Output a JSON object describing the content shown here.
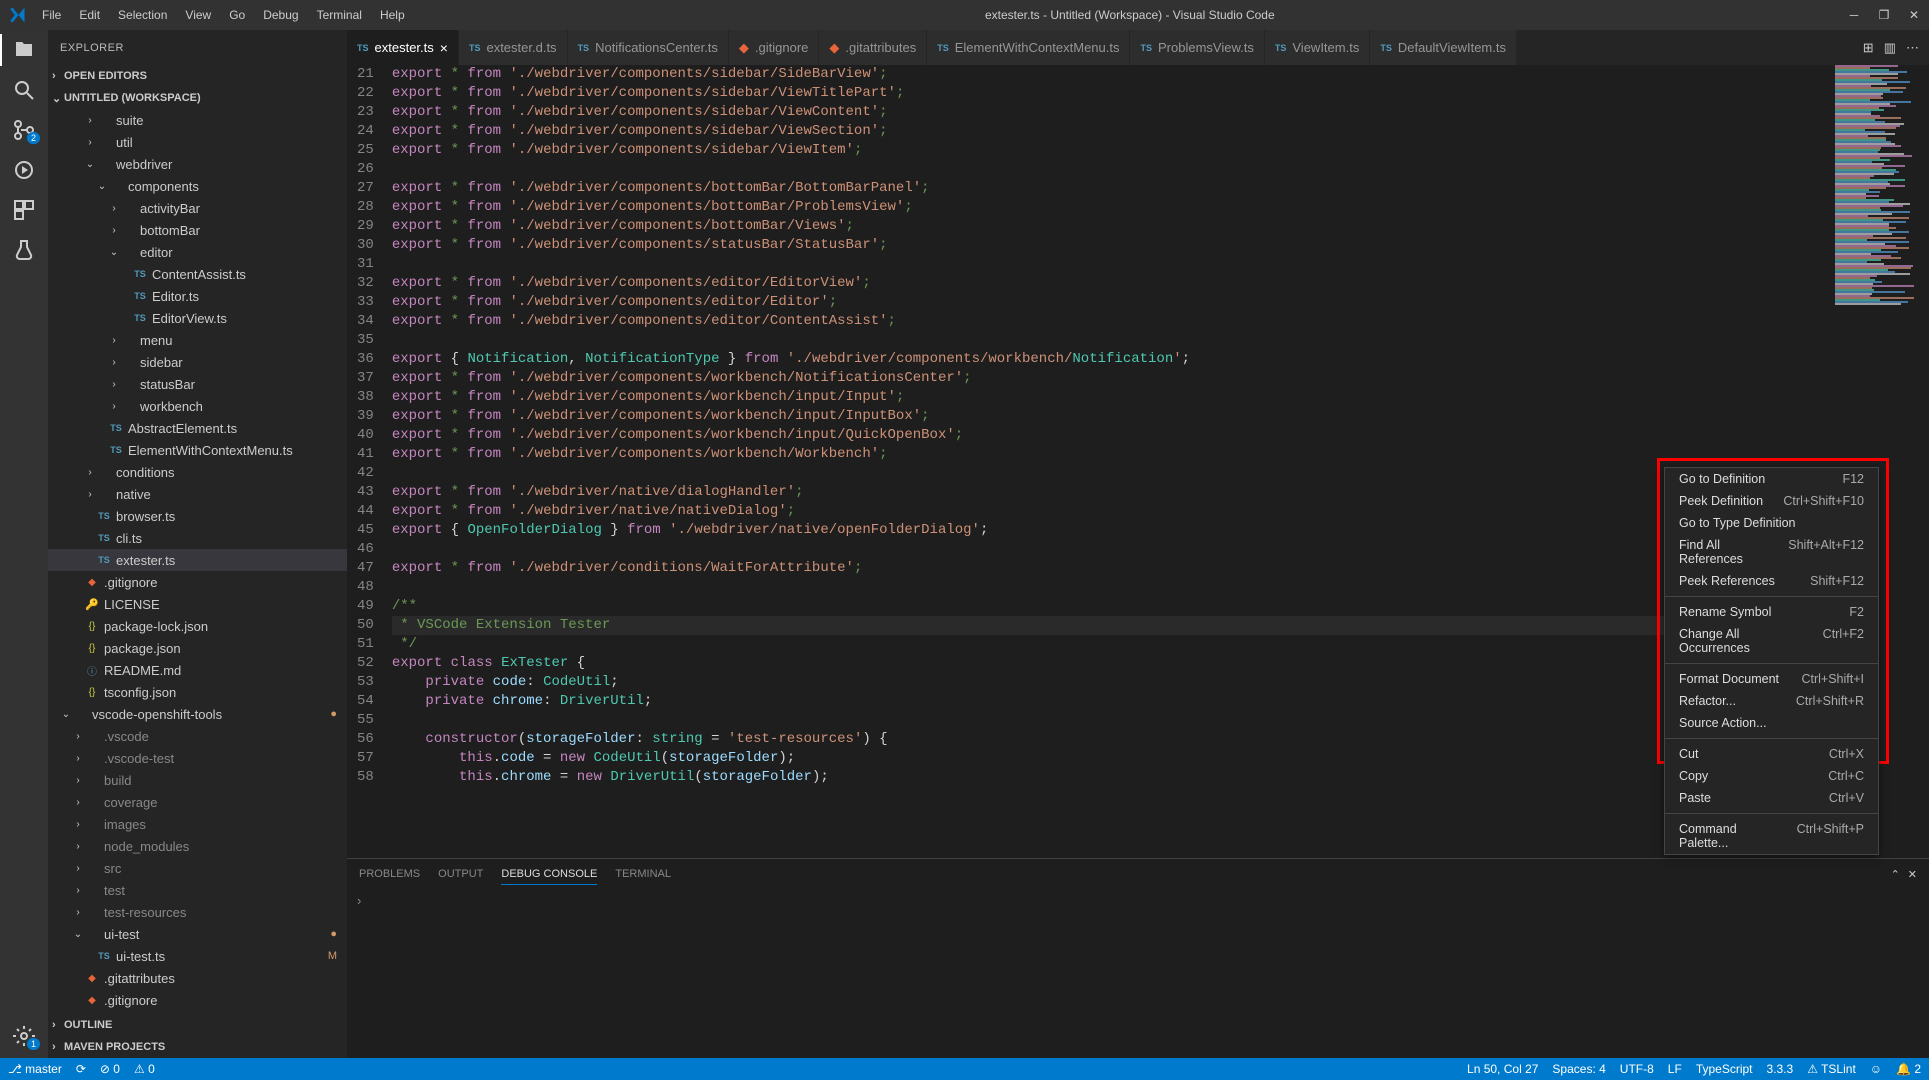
{
  "menu": [
    "File",
    "Edit",
    "Selection",
    "View",
    "Go",
    "Debug",
    "Terminal",
    "Help"
  ],
  "title": "extester.ts - Untitled (Workspace) - Visual Studio Code",
  "explorer": {
    "header": "EXPLORER",
    "sections": {
      "open_editors": "OPEN EDITORS",
      "workspace": "UNTITLED (WORKSPACE)",
      "outline": "OUTLINE",
      "maven": "MAVEN PROJECTS"
    },
    "tree": [
      {
        "d": 3,
        "t": "f",
        "c": "›",
        "n": "suite"
      },
      {
        "d": 3,
        "t": "f",
        "c": "›",
        "n": "util"
      },
      {
        "d": 3,
        "t": "f",
        "c": "⌄",
        "n": "webdriver"
      },
      {
        "d": 4,
        "t": "f",
        "c": "⌄",
        "n": "components"
      },
      {
        "d": 5,
        "t": "f",
        "c": "›",
        "n": "activityBar"
      },
      {
        "d": 5,
        "t": "f",
        "c": "›",
        "n": "bottomBar"
      },
      {
        "d": 5,
        "t": "f",
        "c": "⌄",
        "n": "editor"
      },
      {
        "d": 6,
        "t": "ts",
        "n": "ContentAssist.ts"
      },
      {
        "d": 6,
        "t": "ts",
        "n": "Editor.ts"
      },
      {
        "d": 6,
        "t": "ts",
        "n": "EditorView.ts"
      },
      {
        "d": 5,
        "t": "f",
        "c": "›",
        "n": "menu"
      },
      {
        "d": 5,
        "t": "f",
        "c": "›",
        "n": "sidebar"
      },
      {
        "d": 5,
        "t": "f",
        "c": "›",
        "n": "statusBar"
      },
      {
        "d": 5,
        "t": "f",
        "c": "›",
        "n": "workbench"
      },
      {
        "d": 4,
        "t": "ts",
        "n": "AbstractElement.ts"
      },
      {
        "d": 4,
        "t": "ts",
        "n": "ElementWithContextMenu.ts"
      },
      {
        "d": 3,
        "t": "f",
        "c": "›",
        "n": "conditions"
      },
      {
        "d": 3,
        "t": "f",
        "c": "›",
        "n": "native"
      },
      {
        "d": 3,
        "t": "ts",
        "n": "browser.ts"
      },
      {
        "d": 3,
        "t": "ts",
        "n": "cli.ts"
      },
      {
        "d": 3,
        "t": "ts",
        "n": "extester.ts",
        "sel": true
      },
      {
        "d": 2,
        "t": "file",
        "i": "git",
        "n": ".gitignore"
      },
      {
        "d": 2,
        "t": "file",
        "i": "lic",
        "n": "LICENSE"
      },
      {
        "d": 2,
        "t": "file",
        "i": "json",
        "n": "package-lock.json"
      },
      {
        "d": 2,
        "t": "file",
        "i": "json",
        "n": "package.json"
      },
      {
        "d": 2,
        "t": "file",
        "i": "md",
        "n": "README.md"
      },
      {
        "d": 2,
        "t": "file",
        "i": "json",
        "n": "tsconfig.json"
      },
      {
        "d": 1,
        "t": "f",
        "c": "⌄",
        "n": "vscode-openshift-tools",
        "st": "●"
      },
      {
        "d": 2,
        "t": "fd",
        "c": "›",
        "n": ".vscode"
      },
      {
        "d": 2,
        "t": "fd",
        "c": "›",
        "n": ".vscode-test"
      },
      {
        "d": 2,
        "t": "fd",
        "c": "›",
        "n": "build"
      },
      {
        "d": 2,
        "t": "fd",
        "c": "›",
        "n": "coverage"
      },
      {
        "d": 2,
        "t": "fd",
        "c": "›",
        "n": "images"
      },
      {
        "d": 2,
        "t": "fd",
        "c": "›",
        "n": "node_modules"
      },
      {
        "d": 2,
        "t": "fd",
        "c": "›",
        "n": "src"
      },
      {
        "d": 2,
        "t": "fd",
        "c": "›",
        "n": "test"
      },
      {
        "d": 2,
        "t": "fd",
        "c": "›",
        "n": "test-resources"
      },
      {
        "d": 2,
        "t": "f",
        "c": "⌄",
        "n": "ui-test",
        "st": "●"
      },
      {
        "d": 3,
        "t": "ts",
        "n": "ui-test.ts",
        "st": "M"
      },
      {
        "d": 2,
        "t": "file",
        "i": "git",
        "n": ".gitattributes"
      },
      {
        "d": 2,
        "t": "file",
        "i": "git",
        "n": ".gitignore"
      }
    ]
  },
  "tabs": [
    {
      "l": "extester.ts",
      "active": true,
      "close": true
    },
    {
      "l": "extester.d.ts"
    },
    {
      "l": "NotificationsCenter.ts"
    },
    {
      "l": ".gitignore"
    },
    {
      "l": ".gitattributes"
    },
    {
      "l": "ElementWithContextMenu.ts"
    },
    {
      "l": "ProblemsView.ts"
    },
    {
      "l": "ViewItem.ts"
    },
    {
      "l": "DefaultViewItem.ts"
    }
  ],
  "code_start_line": 21,
  "code": [
    "export * from './webdriver/components/sidebar/SideBarView';",
    "export * from './webdriver/components/sidebar/ViewTitlePart';",
    "export * from './webdriver/components/sidebar/ViewContent';",
    "export * from './webdriver/components/sidebar/ViewSection';",
    "export * from './webdriver/components/sidebar/ViewItem';",
    "",
    "export * from './webdriver/components/bottomBar/BottomBarPanel';",
    "export * from './webdriver/components/bottomBar/ProblemsView';",
    "export * from './webdriver/components/bottomBar/Views';",
    "export * from './webdriver/components/statusBar/StatusBar';",
    "",
    "export * from './webdriver/components/editor/EditorView';",
    "export * from './webdriver/components/editor/Editor';",
    "export * from './webdriver/components/editor/ContentAssist';",
    "",
    "export { Notification, NotificationType } from './webdriver/components/workbench/Notification';",
    "export * from './webdriver/components/workbench/NotificationsCenter';",
    "export * from './webdriver/components/workbench/input/Input';",
    "export * from './webdriver/components/workbench/input/InputBox';",
    "export * from './webdriver/components/workbench/input/QuickOpenBox';",
    "export * from './webdriver/components/workbench/Workbench';",
    "",
    "export * from './webdriver/native/dialogHandler';",
    "export * from './webdriver/native/nativeDialog';",
    "export { OpenFolderDialog } from './webdriver/native/openFolderDialog';",
    "",
    "export * from './webdriver/conditions/WaitForAttribute';",
    "",
    "/**",
    " * VSCode Extension Tester",
    " */",
    "export class ExTester {",
    "    private code: CodeUtil;",
    "    private chrome: DriverUtil;",
    "",
    "    constructor(storageFolder: string = 'test-resources') {",
    "        this.code = new CodeUtil(storageFolder);",
    "        this.chrome = new DriverUtil(storageFolder);"
  ],
  "panel": {
    "tabs": [
      "PROBLEMS",
      "OUTPUT",
      "DEBUG CONSOLE",
      "TERMINAL"
    ],
    "active": 2
  },
  "context_menu": [
    {
      "l": "Go to Definition",
      "s": "F12"
    },
    {
      "l": "Peek Definition",
      "s": "Ctrl+Shift+F10"
    },
    {
      "l": "Go to Type Definition",
      "s": ""
    },
    {
      "l": "Find All References",
      "s": "Shift+Alt+F12"
    },
    {
      "l": "Peek References",
      "s": "Shift+F12"
    },
    {
      "sep": true
    },
    {
      "l": "Rename Symbol",
      "s": "F2"
    },
    {
      "l": "Change All Occurrences",
      "s": "Ctrl+F2"
    },
    {
      "sep": true
    },
    {
      "l": "Format Document",
      "s": "Ctrl+Shift+I"
    },
    {
      "l": "Refactor...",
      "s": "Ctrl+Shift+R"
    },
    {
      "l": "Source Action...",
      "s": ""
    },
    {
      "sep": true
    },
    {
      "l": "Cut",
      "s": "Ctrl+X"
    },
    {
      "l": "Copy",
      "s": "Ctrl+C"
    },
    {
      "l": "Paste",
      "s": "Ctrl+V"
    },
    {
      "sep": true
    },
    {
      "l": "Command Palette...",
      "s": "Ctrl+Shift+P"
    }
  ],
  "status": {
    "branch": "master",
    "sync": "⟳",
    "errors": "⊘ 0",
    "warnings": "⚠ 0",
    "ln": "Ln 50, Col 27",
    "spaces": "Spaces: 4",
    "enc": "UTF-8",
    "eol": "LF",
    "lang": "TypeScript",
    "ver": "3.3.3",
    "tslint": "⚠ TSLint",
    "smiley": "☺",
    "bell": "🔔 2"
  },
  "scm_badge": "2",
  "settings_badge": "1"
}
